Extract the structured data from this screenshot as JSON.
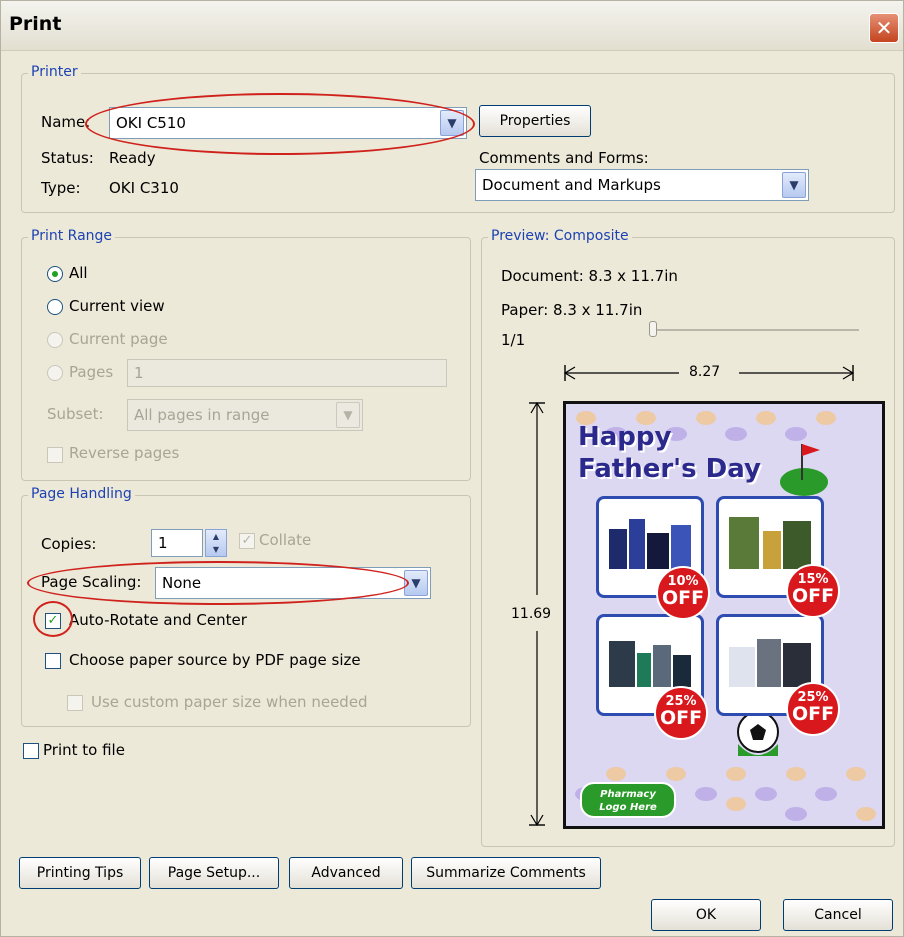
{
  "window": {
    "title": "Print",
    "close_glyph": "✕"
  },
  "printer": {
    "legend": "Printer",
    "name_label": "Name:",
    "name_value": "OKI C510",
    "status_label": "Status:",
    "status_value": "Ready",
    "type_label": "Type:",
    "type_value": "OKI C310",
    "properties_button": "Properties",
    "comments_label": "Comments and Forms:",
    "comments_value": "Document and Markups"
  },
  "print_range": {
    "legend": "Print Range",
    "all": "All",
    "current_view": "Current view",
    "current_page": "Current page",
    "pages": "Pages",
    "pages_value": "1",
    "subset_label": "Subset:",
    "subset_value": "All pages in range",
    "reverse_pages": "Reverse pages"
  },
  "page_handling": {
    "legend": "Page Handling",
    "copies_label": "Copies:",
    "copies_value": "1",
    "collate": "Collate",
    "page_scaling_label": "Page Scaling:",
    "page_scaling_value": "None",
    "auto_rotate": "Auto-Rotate and Center",
    "choose_paper": "Choose paper source by PDF page size",
    "custom_paper": "Use custom paper size when needed"
  },
  "print_to_file": "Print to file",
  "preview": {
    "legend": "Preview: Composite",
    "document": "Document: 8.3 x 11.7in",
    "paper": "Paper: 8.3 x 11.7in",
    "page_counter": "1/1",
    "width_dim": "8.27",
    "height_dim": "11.69",
    "poster": {
      "line1": "Happy",
      "line2": "Father's Day",
      "badges": [
        {
          "pct": "10%",
          "off": "OFF"
        },
        {
          "pct": "15%",
          "off": "OFF"
        },
        {
          "pct": "25%",
          "off": "OFF"
        },
        {
          "pct": "25%",
          "off": "OFF"
        }
      ],
      "logo_line1": "Pharmacy",
      "logo_line2": "Logo Here"
    }
  },
  "buttons": {
    "printing_tips": "Printing Tips",
    "page_setup": "Page Setup...",
    "advanced": "Advanced",
    "summarize": "Summarize Comments",
    "ok": "OK",
    "cancel": "Cancel"
  },
  "colors": {
    "highlight_red": "#d0221c",
    "group_label": "#1d42b3",
    "dialog_bg": "#ece9d8"
  }
}
